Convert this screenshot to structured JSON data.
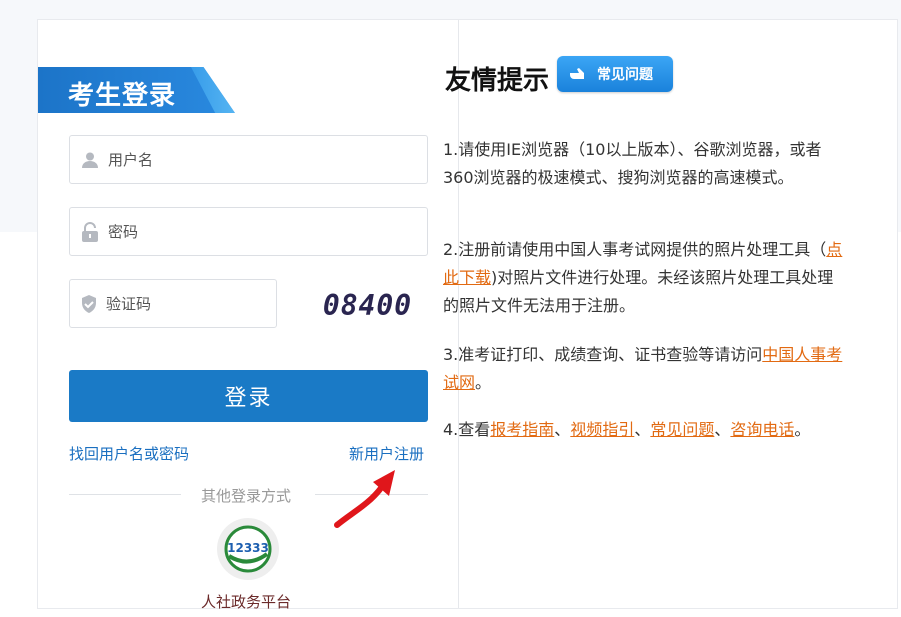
{
  "login": {
    "title": "考生登录",
    "username_placeholder": "用户名",
    "password_placeholder": "密码",
    "captcha_placeholder": "验证码",
    "captcha_code": "08400",
    "submit_label": "登录",
    "forgot_link": "找回用户名或密码",
    "register_link": "新用户注册",
    "other_login": "其他登录方式",
    "portal_logo_text": "12333",
    "portal_label": "人社政务平台"
  },
  "tips": {
    "title": "友情提示",
    "faq_badge": "常见问题",
    "tip1": "1.请使用IE浏览器（10以上版本）、谷歌浏览器，或者360浏览器的极速模式、搜狗浏览器的高速模式。",
    "tip2_before": "2.注册前请使用中国人事考试网提供的照片处理工具（",
    "tip2_link": "点此下载",
    "tip2_after": ")对照片文件进行处理。未经该照片处理工具处理的照片文件无法用于注册。",
    "tip3_before": "3.准考证打印、成绩查询、证书查验等请访问",
    "tip3_link": "中国人事考试网",
    "tip3_after": "。",
    "tip4_before": "4.查看",
    "tip4_link1": "报考指南",
    "tip4_sep1": "、",
    "tip4_link2": "视频指引",
    "tip4_sep2": "、",
    "tip4_link3": "常见问题",
    "tip4_sep3": "、",
    "tip4_link4": "咨询电话",
    "tip4_after": "。"
  },
  "colors": {
    "primary": "#1a7ac6",
    "link_blue": "#1a6fc0",
    "link_orange": "#e26a12"
  }
}
